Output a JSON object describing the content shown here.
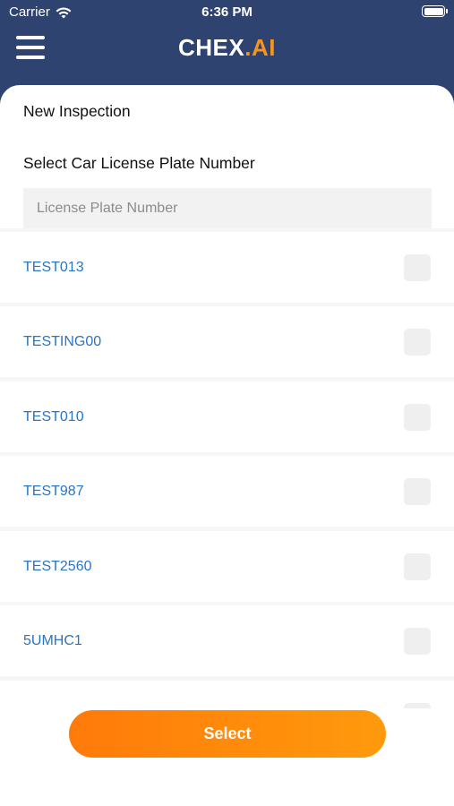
{
  "status_bar": {
    "carrier": "Carrier",
    "time": "6:36 PM",
    "wifi_icon": "wifi-icon",
    "battery_icon": "battery-icon"
  },
  "header": {
    "menu_icon": "hamburger-menu-icon",
    "logo_main": "CHEX",
    "logo_accent": ".AI",
    "accent_color": "#f7941d",
    "background_color": "#2f4370"
  },
  "main": {
    "title": "New Inspection",
    "section_label": "Select Car License Plate Number",
    "search": {
      "placeholder": "License Plate Number",
      "value": ""
    },
    "plates": [
      {
        "label": "TEST013",
        "checked": false
      },
      {
        "label": "TESTING00",
        "checked": false
      },
      {
        "label": "TEST010",
        "checked": false
      },
      {
        "label": "TEST987",
        "checked": false
      },
      {
        "label": "TEST2560",
        "checked": false
      },
      {
        "label": "5UMHC1",
        "checked": false
      }
    ],
    "link_color": "#2a74c2"
  },
  "footer": {
    "select_label": "Select",
    "button_color": "#ff8a0b"
  }
}
